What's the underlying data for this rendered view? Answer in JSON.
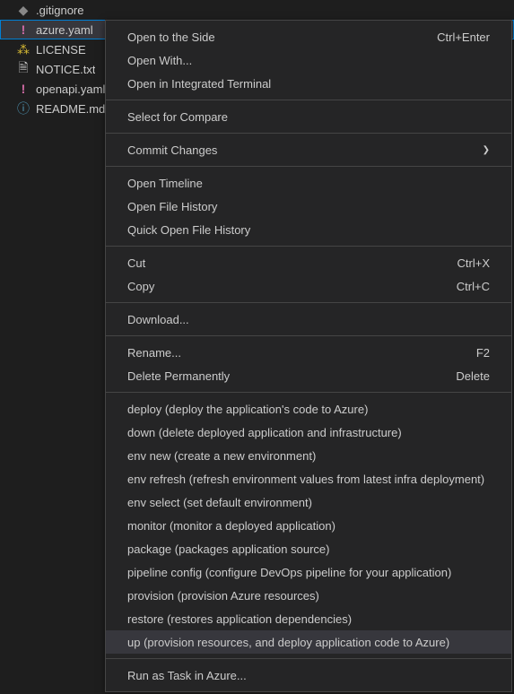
{
  "explorer": {
    "files": [
      {
        "name": ".gitignore",
        "icon": "gitignore",
        "glyph": "◆"
      },
      {
        "name": "azure.yaml",
        "icon": "yaml",
        "glyph": "!",
        "selected": true
      },
      {
        "name": "LICENSE",
        "icon": "license",
        "glyph": "⁂"
      },
      {
        "name": "NOTICE.txt",
        "icon": "txt",
        "glyph": "🗎"
      },
      {
        "name": "openapi.yaml",
        "icon": "yaml",
        "glyph": "!"
      },
      {
        "name": "README.md",
        "icon": "readme",
        "glyph": "ⓘ"
      }
    ]
  },
  "contextMenu": {
    "groups": [
      [
        {
          "label": "Open to the Side",
          "shortcut": "Ctrl+Enter"
        },
        {
          "label": "Open With..."
        },
        {
          "label": "Open in Integrated Terminal"
        }
      ],
      [
        {
          "label": "Select for Compare"
        }
      ],
      [
        {
          "label": "Commit Changes",
          "submenu": true
        }
      ],
      [
        {
          "label": "Open Timeline"
        },
        {
          "label": "Open File History"
        },
        {
          "label": "Quick Open File History"
        }
      ],
      [
        {
          "label": "Cut",
          "shortcut": "Ctrl+X"
        },
        {
          "label": "Copy",
          "shortcut": "Ctrl+C"
        }
      ],
      [
        {
          "label": "Download..."
        }
      ],
      [
        {
          "label": "Rename...",
          "shortcut": "F2"
        },
        {
          "label": "Delete Permanently",
          "shortcut": "Delete"
        }
      ],
      [
        {
          "label": "deploy (deploy the application's code to Azure)"
        },
        {
          "label": "down (delete deployed application and infrastructure)"
        },
        {
          "label": "env new (create a new environment)"
        },
        {
          "label": "env refresh (refresh environment values from latest infra deployment)"
        },
        {
          "label": "env select (set default environment)"
        },
        {
          "label": "monitor (monitor a deployed application)"
        },
        {
          "label": "package (packages application source)"
        },
        {
          "label": "pipeline config (configure DevOps pipeline for your application)"
        },
        {
          "label": "provision (provision Azure resources)"
        },
        {
          "label": "restore (restores application dependencies)"
        },
        {
          "label": "up (provision resources, and deploy application code to Azure)",
          "highlighted": true
        }
      ],
      [
        {
          "label": "Run as Task in Azure..."
        }
      ]
    ]
  }
}
